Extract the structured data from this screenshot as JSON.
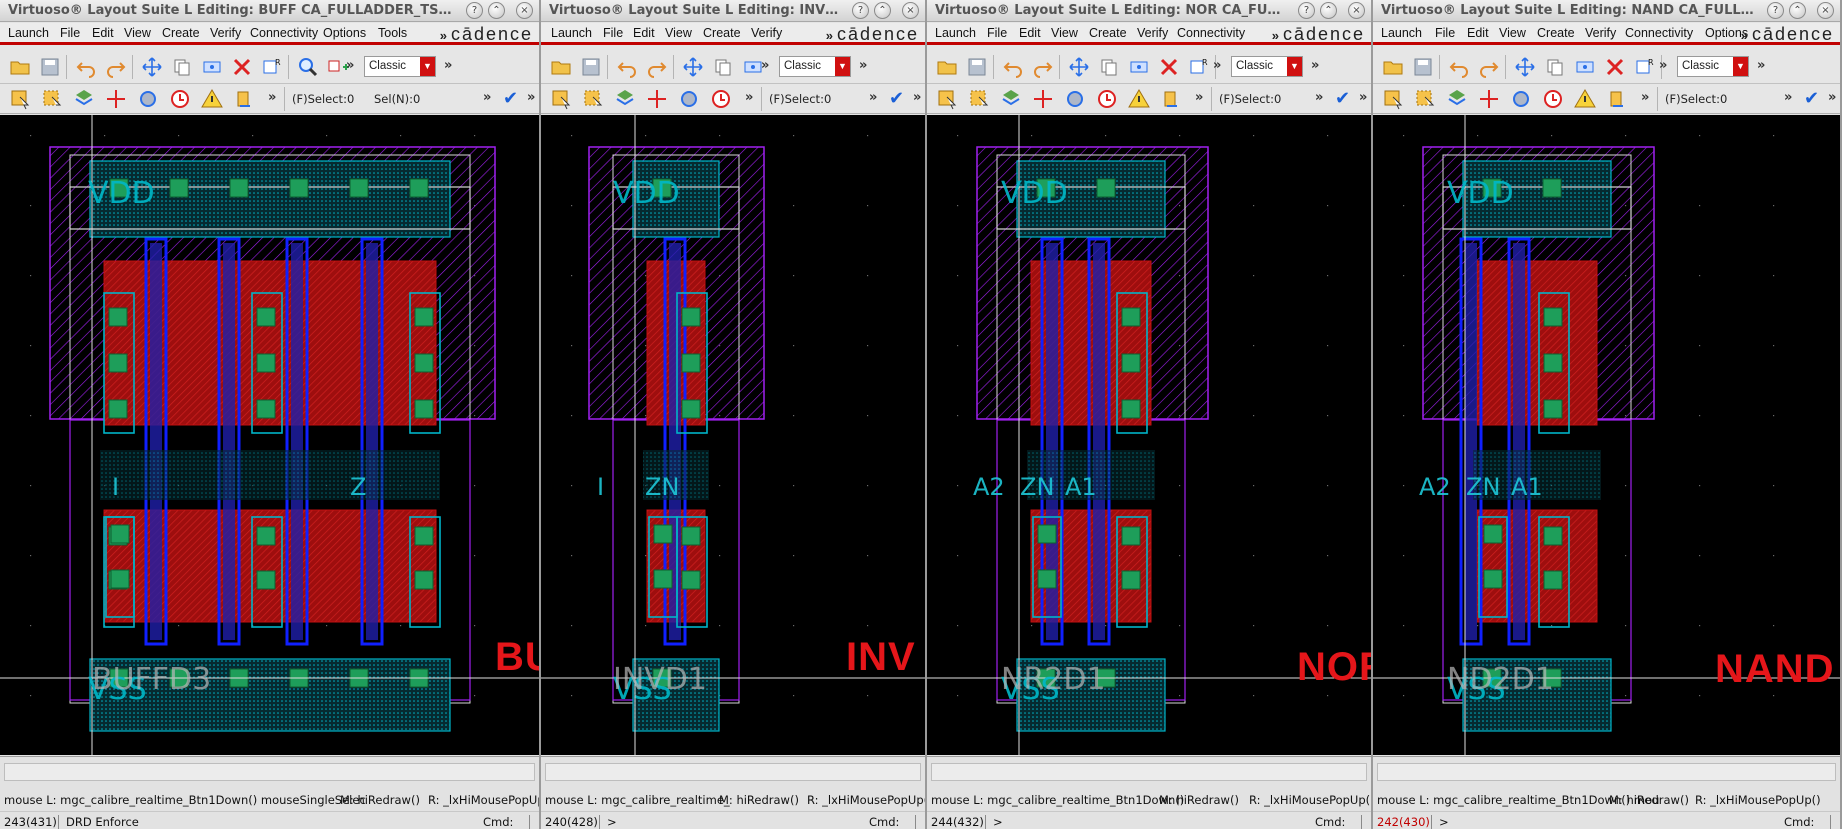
{
  "windows": [
    {
      "id": "buf",
      "title": "Virtuoso® Layout Suite L Editing: BUFF CA_FULLADDER_TSMC l...",
      "menus": [
        "Launch",
        "File",
        "Edit",
        "View",
        "Create",
        "Verify",
        "Connectivity",
        "Options",
        "Tools"
      ],
      "brand": "cādence",
      "view_mode": "Classic",
      "select_info": "(F)Select:0",
      "sel_n": "Sel(N):0",
      "cell_name": "BUFFD3",
      "pin_labels": [
        "VDD",
        "VSS",
        "I",
        "Z"
      ],
      "overlay_label": "BUF",
      "mouse_l": "mouse L: mgc_calibre_realtime_Btn1Down() mouseSingleSelec",
      "mouse_m": "M: hiRedraw()",
      "mouse_r": "R: _lxHiMousePopUp()",
      "coord": "243(431)",
      "cmd_prompt": "DRD Enforce",
      "cmd_label": "Cmd:"
    },
    {
      "id": "inv",
      "title": "Virtuoso® Layout Suite L Editing: INV C...",
      "menus": [
        "Launch",
        "File",
        "Edit",
        "View",
        "Create",
        "Verify"
      ],
      "brand": "cādence",
      "view_mode": "Classic",
      "select_info": "(F)Select:0",
      "sel_n": "",
      "cell_name": "INVD1",
      "pin_labels": [
        "VDD",
        "VSS",
        "I",
        "ZN"
      ],
      "overlay_label": "INV",
      "mouse_l": "mouse L: mgc_calibre_realtime_",
      "mouse_m": "M: hiRedraw()",
      "mouse_r": "R: _lxHiMousePopUp()",
      "coord": "240(428)",
      "cmd_prompt": ">",
      "cmd_label": "Cmd:"
    },
    {
      "id": "nor",
      "title": "Virtuoso® Layout Suite L Editing: NOR CA_FULLA...",
      "menus": [
        "Launch",
        "File",
        "Edit",
        "View",
        "Create",
        "Verify",
        "Connectivity"
      ],
      "brand": "cādence",
      "view_mode": "Classic",
      "select_info": "(F)Select:0",
      "sel_n": "",
      "cell_name": "NR2D1",
      "pin_labels": [
        "VDD",
        "VSS",
        "A2",
        "ZN",
        "A1"
      ],
      "overlay_label": "NOR",
      "mouse_l": "mouse L: mgc_calibre_realtime_Btn1Down()",
      "mouse_m": "M: hiRedraw()",
      "mouse_r": "R: _lxHiMousePopUp()",
      "coord": "244(432)",
      "cmd_prompt": ">",
      "cmd_label": "Cmd:"
    },
    {
      "id": "nand",
      "title": "Virtuoso® Layout Suite L Editing: NAND CA_FULLADD...",
      "menus": [
        "Launch",
        "File",
        "Edit",
        "View",
        "Create",
        "Verify",
        "Connectivity",
        "Options"
      ],
      "brand": "cādence",
      "view_mode": "Classic",
      "select_info": "(F)Select:0",
      "sel_n": "",
      "cell_name": "ND2D1",
      "pin_labels": [
        "VDD",
        "VSS",
        "A2",
        "ZN",
        "A1"
      ],
      "overlay_label": "NAND",
      "mouse_l": "mouse L: mgc_calibre_realtime_Btn1Down() mou",
      "mouse_m": "M: hiRedraw()",
      "mouse_r": "R: _lxHiMousePopUp()",
      "coord": "242(430)",
      "cmd_prompt": ">",
      "cmd_label": "Cmd:"
    }
  ],
  "colors": {
    "canvas_bg": "#000000",
    "nwell": "#a020f0",
    "diffusion": "#c01010",
    "poly": "#1020ff",
    "metal1": "#00b4c8",
    "contact": "#1e9e5a",
    "boundary": "#d8d8d8",
    "overlay_label": "#e5161a",
    "menubar_accent": "#c00000"
  },
  "toolbar_icons": [
    "open-icon",
    "save-icon",
    "undo-icon",
    "redo-icon",
    "move-icon",
    "copy-icon",
    "stretch-icon",
    "delete-icon",
    "properties-icon",
    "zoom-icon",
    "create-instance-icon"
  ],
  "toolbar2_icons": [
    "select-icon",
    "partial-select-icon",
    "layer-icon",
    "ruler-icon",
    "route-icon",
    "wire-icon",
    "warning-icon",
    "pin-icon"
  ]
}
